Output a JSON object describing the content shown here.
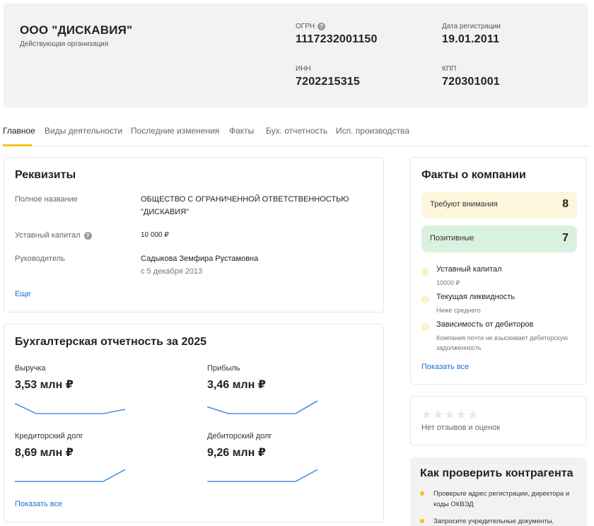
{
  "header": {
    "name": "ООО \"ДИСКАВИЯ\"",
    "status": "Действующая организация",
    "ogrn_label": "ОГРН",
    "ogrn": "1117232001150",
    "reg_date_label": "Дата регистрации",
    "reg_date": "19.01.2011",
    "inn_label": "ИНН",
    "inn": "7202215315",
    "kpp_label": "КПП",
    "kpp": "720301001",
    "help_glyph": "?"
  },
  "tabs": [
    {
      "label": "Главное",
      "active": true
    },
    {
      "label": "Виды деятельности"
    },
    {
      "label": "Последние изменения"
    },
    {
      "label": "Факты"
    },
    {
      "label": "Бух. отчетность"
    },
    {
      "label": "Исп. производства"
    }
  ],
  "requisites": {
    "title": "Реквизиты",
    "full_name_label": "Полное название",
    "full_name_line1": "ОБЩЕСТВО С ОГРАНИЧЕННОЙ ОТВЕТСТВЕННОСТЬЮ",
    "full_name_line2": "\"ДИСКАВИЯ\"",
    "capital_label": "Уставный капитал",
    "capital": "10 000 ₽",
    "director_label": "Руководитель",
    "director": "Садыкова Земфира Рустамовна",
    "director_since": "с 5 декабря 2013",
    "more_link": "Еще"
  },
  "accounting": {
    "title": "Бухгалтерская отчетность за 2025",
    "metrics": [
      {
        "label": "Выручка",
        "value": "3,53 млн ₽",
        "trend": [
          0.6,
          0.0,
          0.0,
          0.25
        ]
      },
      {
        "label": "Прибыль",
        "value": "3,46 млн ₽",
        "trend": [
          0.4,
          0.0,
          0.0,
          0.75
        ]
      },
      {
        "label": "Кредиторский долг",
        "value": "8,69 млн ₽",
        "trend": [
          0.0,
          0.0,
          0.0,
          0.7
        ]
      },
      {
        "label": "Дебиторский долг",
        "value": "9,26 млн ₽",
        "trend": [
          0.0,
          0.0,
          0.0,
          0.7
        ]
      }
    ],
    "show_all": "Показать все",
    "line_color": "#4a90e2"
  },
  "facts": {
    "title": "Факты о компании",
    "attention_label": "Требуют внимания",
    "attention_count": "8",
    "attention_color": "#fdf6dc",
    "positive_label": "Позитивные",
    "positive_count": "7",
    "positive_color": "#d9f2df",
    "items": [
      {
        "title": "Уставный капитал",
        "sub": "10000 ₽"
      },
      {
        "title": "Текущая ликвидность",
        "sub": "Ниже среднего"
      },
      {
        "title": "Зависимость от дебиторов",
        "sub": "Компания почти не взыскивает дебиторскую задолженность"
      }
    ],
    "show_all": "Показать все"
  },
  "reviews": {
    "stars": "★★★★★",
    "text": "Нет отзывов и оценок"
  },
  "check": {
    "title": "Как проверить контрагента",
    "items": [
      "Проверьте адрес регистрации, директора и коды ОКВЭД",
      "Запросите учредительные документы,"
    ]
  }
}
